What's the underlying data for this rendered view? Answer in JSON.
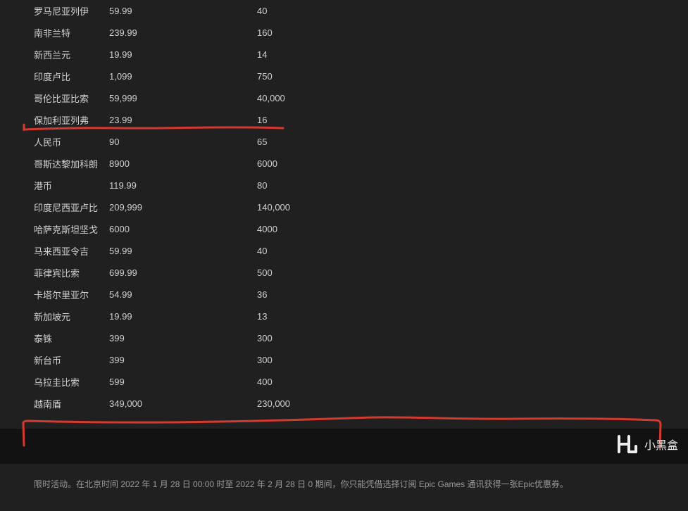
{
  "price_rows": [
    {
      "currency": "罗马尼亚列伊",
      "v1": "59.99",
      "v2": "40"
    },
    {
      "currency": "南非兰特",
      "v1": "239.99",
      "v2": "160"
    },
    {
      "currency": "新西兰元",
      "v1": "19.99",
      "v2": "14"
    },
    {
      "currency": "印度卢比",
      "v1": "1,099",
      "v2": "750"
    },
    {
      "currency": "哥伦比亚比索",
      "v1": "59,999",
      "v2": "40,000"
    },
    {
      "currency": "保加利亚列弗",
      "v1": "23.99",
      "v2": "16"
    },
    {
      "currency": "人民币",
      "v1": "90",
      "v2": "65"
    },
    {
      "currency": "哥斯达黎加科朗",
      "v1": "8900",
      "v2": "6000"
    },
    {
      "currency": "港币",
      "v1": "119.99",
      "v2": "80"
    },
    {
      "currency": "印度尼西亚卢比",
      "v1": "209,999",
      "v2": "140,000"
    },
    {
      "currency": "哈萨克斯坦坚戈",
      "v1": "6000",
      "v2": "4000"
    },
    {
      "currency": "马来西亚令吉",
      "v1": "59.99",
      "v2": "40"
    },
    {
      "currency": "菲律宾比索",
      "v1": "699.99",
      "v2": "500"
    },
    {
      "currency": "卡塔尔里亚尔",
      "v1": "54.99",
      "v2": "36"
    },
    {
      "currency": "新加坡元",
      "v1": "19.99",
      "v2": "13"
    },
    {
      "currency": "泰铢",
      "v1": "399",
      "v2": "300"
    },
    {
      "currency": "新台币",
      "v1": "399",
      "v2": "300"
    },
    {
      "currency": "乌拉圭比索",
      "v1": "599",
      "v2": "400"
    },
    {
      "currency": "越南盾",
      "v1": "349,000",
      "v2": "230,000"
    }
  ],
  "footer_text": "限时活动。在北京时间 2022 年 1 月 28 日 00:00 时至 2022 年 2 月 28 日 0 期间，你只能凭借选择订阅 Epic Games 通讯获得一张Epic优惠券。",
  "watermark_text": "小黑盒",
  "annotation_color": "#d43a2f"
}
